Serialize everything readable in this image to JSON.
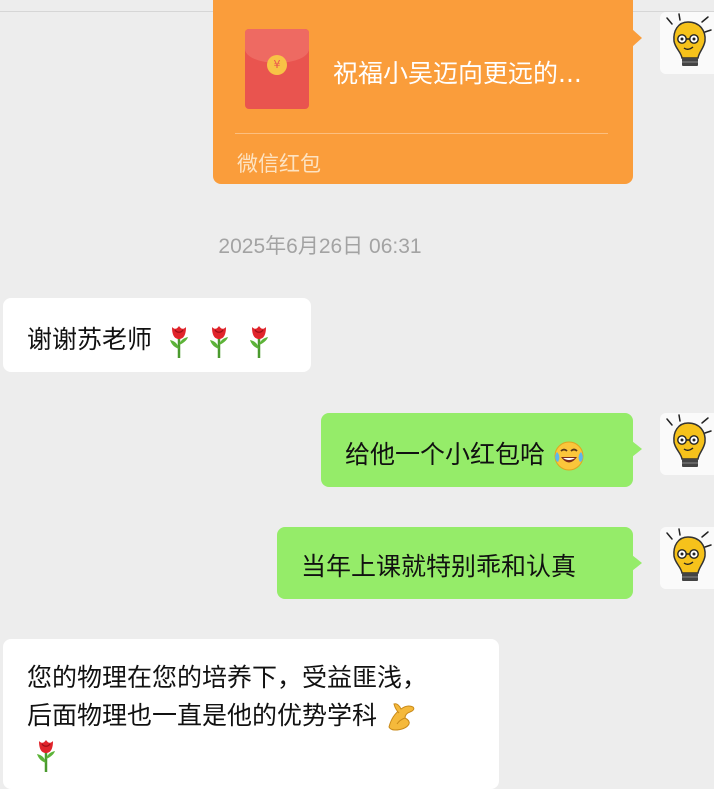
{
  "red_packet": {
    "title": "祝福小吴迈向更远的...",
    "label": "微信红包",
    "coin_symbol": "¥"
  },
  "timestamp": "2025年6月26日 06:31",
  "messages": [
    {
      "direction": "in",
      "text": "谢谢苏老师",
      "trailing_emoji": [
        "rose",
        "rose",
        "rose"
      ]
    },
    {
      "direction": "out",
      "text": "给他一个小红包哈",
      "trailing_emoji": [
        "rolling-on-floor-laughing"
      ]
    },
    {
      "direction": "out",
      "text": "当年上课就特别乖和认真"
    },
    {
      "direction": "in",
      "line1": "您的物理在您的培养下，受益匪浅，",
      "line2": "后面物理也一直是他的优势学科",
      "trailing_emoji": [
        "ok-hand",
        "rose"
      ]
    }
  ],
  "avatar": {
    "icon": "lightbulb-face-icon"
  },
  "colors": {
    "background": "#ededed",
    "outgoing_bubble": "#95ec69",
    "incoming_bubble": "#ffffff",
    "red_packet": "#fa9d3b",
    "envelope": "#e9544f",
    "timestamp_text": "#a3a3a3"
  }
}
